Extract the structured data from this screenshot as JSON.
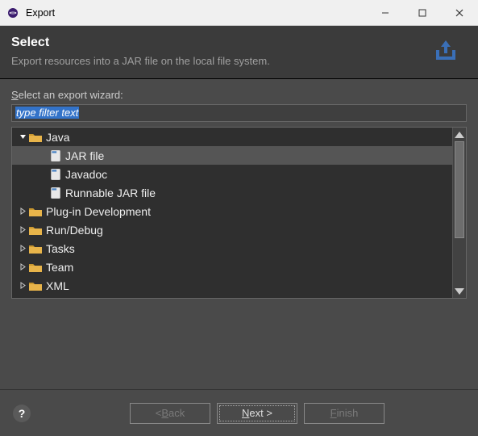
{
  "window": {
    "title": "Export"
  },
  "header": {
    "title": "Select",
    "desc": "Export resources into a JAR file on the local file system."
  },
  "labels": {
    "select_wizard_pre": "S",
    "select_wizard_post": "elect an export wizard:",
    "filter_text": "type filter text"
  },
  "tree": {
    "items": [
      {
        "label": "Java",
        "type": "folder",
        "level": 0,
        "expanded": true
      },
      {
        "label": "JAR file",
        "type": "file",
        "level": 1,
        "selected": true
      },
      {
        "label": "Javadoc",
        "type": "file",
        "level": 1
      },
      {
        "label": "Runnable JAR file",
        "type": "file",
        "level": 1
      },
      {
        "label": "Plug-in Development",
        "type": "folder",
        "level": 0,
        "expanded": false
      },
      {
        "label": "Run/Debug",
        "type": "folder",
        "level": 0,
        "expanded": false
      },
      {
        "label": "Tasks",
        "type": "folder",
        "level": 0,
        "expanded": false
      },
      {
        "label": "Team",
        "type": "folder",
        "level": 0,
        "expanded": false
      },
      {
        "label": "XML",
        "type": "folder",
        "level": 0,
        "expanded": false
      }
    ]
  },
  "buttons": {
    "back_pre": "< ",
    "back_u": "B",
    "back_post": "ack",
    "next_u": "N",
    "next_post": "ext >",
    "finish_u": "F",
    "finish_post": "inish"
  }
}
